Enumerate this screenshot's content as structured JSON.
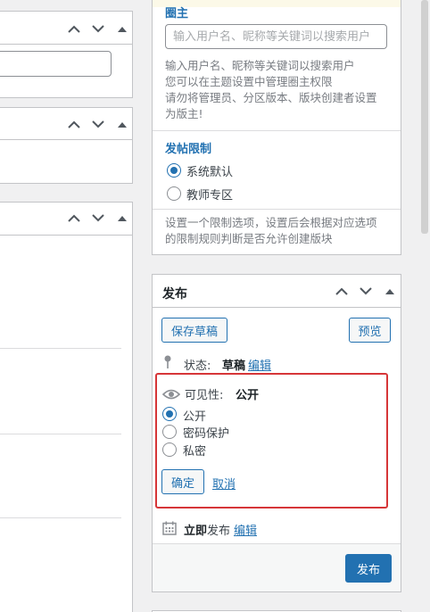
{
  "left_panels": {
    "collapse_label": "▲"
  },
  "forum_settings": {
    "moderator": {
      "title": "圈主",
      "placeholder": "输入用户名、昵称等关键词以搜索用户",
      "desc_lines": [
        "输入用户名、昵称等关键词以搜索用户",
        "您可以在主题设置中管理圈主权限",
        "请勿将管理员、分区版本、版块创建者设置",
        "为版主!"
      ]
    },
    "post_limit": {
      "title": "发帖限制",
      "options": [
        {
          "label": "系统默认",
          "checked": true
        },
        {
          "label": "教师专区",
          "checked": false
        }
      ],
      "desc_lines": [
        "设置一个限制选项，设置后会根据对应选项",
        "的限制规则判断是否允许创建版块"
      ]
    }
  },
  "publish": {
    "title": "发布",
    "save_draft": "保存草稿",
    "preview": "预览",
    "status_label": "状态:",
    "status_value": "草稿",
    "edit": "编辑",
    "visibility_label": "可见性:",
    "visibility_value": "公开",
    "visibility_options": [
      {
        "label": "公开",
        "checked": true
      },
      {
        "label": "密码保护",
        "checked": false
      },
      {
        "label": "私密",
        "checked": false
      }
    ],
    "ok": "确定",
    "cancel": "取消",
    "immediate_strong": "立即",
    "immediate_rest": "发布",
    "publish_button": "发布"
  },
  "colors": {
    "accent": "#2271b1",
    "highlight_border": "#d63638"
  }
}
